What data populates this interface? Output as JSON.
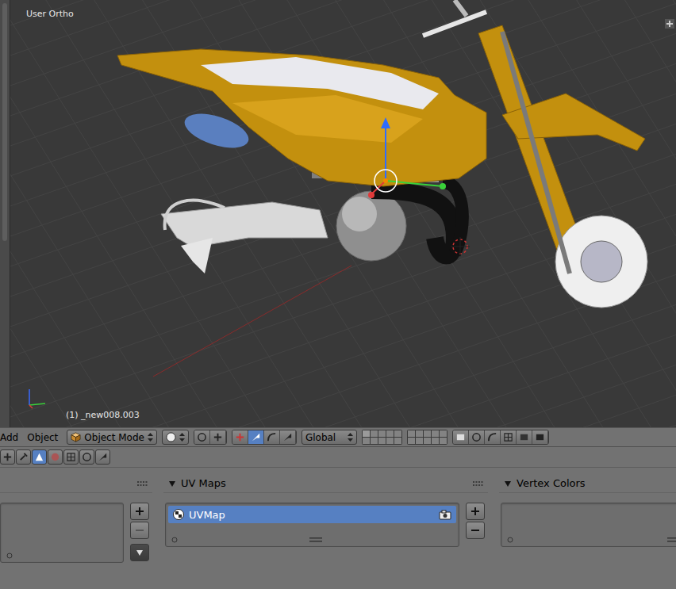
{
  "viewport": {
    "view_label": "User Ortho",
    "object_label": "(1) _new008.003"
  },
  "header": {
    "menus": [
      "Add",
      "Object"
    ],
    "mode": "Object Mode",
    "orientation": "Global"
  },
  "panels": {
    "uv_maps": {
      "title": "UV Maps",
      "items": [
        {
          "name": "UVMap",
          "selected": true,
          "active_render": true
        }
      ]
    },
    "vertex_colors": {
      "title": "Vertex Colors",
      "items": []
    }
  }
}
